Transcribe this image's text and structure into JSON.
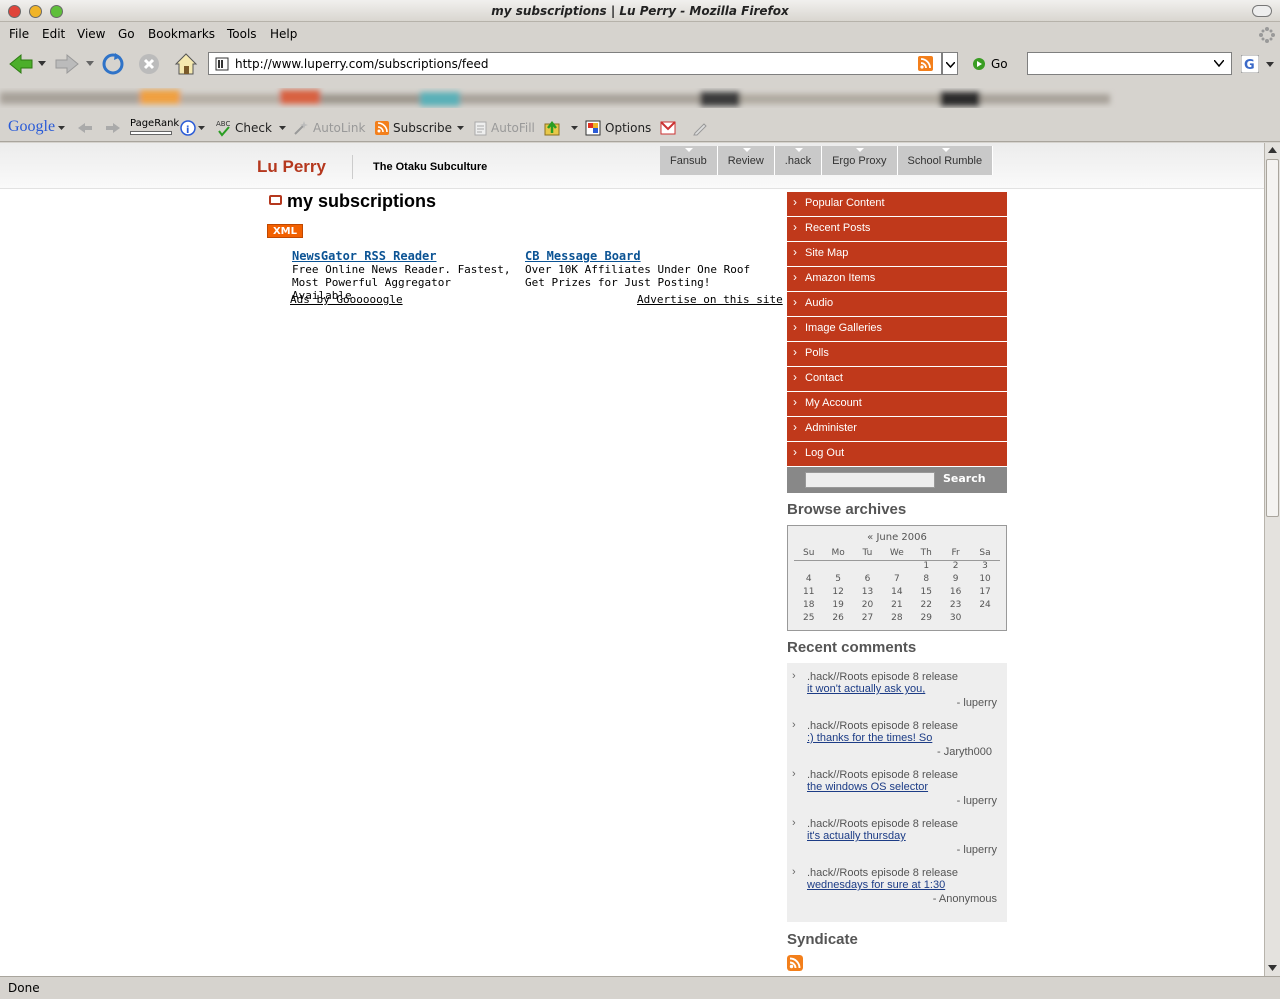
{
  "window": {
    "title": "my subscriptions | Lu Perry - Mozilla Firefox"
  },
  "menubar": {
    "items": [
      "File",
      "Edit",
      "View",
      "Go",
      "Bookmarks",
      "Tools",
      "Help"
    ]
  },
  "navbar": {
    "url": "http://www.luperry.com/subscriptions/feed",
    "go_label": "Go"
  },
  "googlebar": {
    "logo": "Google",
    "pagerank": "PageRank",
    "check": "Check",
    "autolink": "AutoLink",
    "subscribe": "Subscribe",
    "autofill": "AutoFill",
    "options": "Options"
  },
  "status": "Done",
  "site": {
    "name": "Lu Perry",
    "slogan": "The Otaku Subculture"
  },
  "tabs": [
    "Fansub",
    "Review",
    ".hack",
    "Ergo Proxy",
    "School Rumble"
  ],
  "page": {
    "title": "my subscriptions",
    "xml_badge": "XML"
  },
  "ads": [
    {
      "title": "NewsGator RSS Reader",
      "text": "Free Online News Reader. Fastest, Most Powerful Aggregator Available"
    },
    {
      "title": "CB Message Board",
      "text": "Over 10K Affiliates Under One Roof Get Prizes for Just Posting!"
    }
  ],
  "ads_footer": {
    "left": "Ads by Goooooogle",
    "right": "Advertise on this site"
  },
  "nav": [
    "Popular Content",
    "Recent Posts",
    "Site Map",
    "Amazon Items",
    "Audio",
    "Image Galleries",
    "Polls",
    "Contact",
    "My Account",
    "Administer",
    "Log Out"
  ],
  "search": {
    "button": "Search"
  },
  "archives": {
    "title": "Browse archives",
    "month": "« June 2006",
    "days": [
      "Su",
      "Mo",
      "Tu",
      "We",
      "Th",
      "Fr",
      "Sa"
    ],
    "weeks": [
      [
        "",
        "",
        "",
        "",
        "1",
        "2",
        "3"
      ],
      [
        "4",
        "5",
        "6",
        "7",
        "8",
        "9",
        "10"
      ],
      [
        "11",
        "12",
        "13",
        "14",
        "15",
        "16",
        "17"
      ],
      [
        "18",
        "19",
        "20",
        "21",
        "22",
        "23",
        "24"
      ],
      [
        "25",
        "26",
        "27",
        "28",
        "29",
        "30",
        ""
      ]
    ]
  },
  "comments": {
    "title": "Recent comments",
    "items": [
      {
        "post": ".hack//Roots episode 8 release",
        "link": "it won't actually ask you,",
        "author": "- luperry"
      },
      {
        "post": ".hack//Roots episode 8 release",
        "link": ":) thanks for the times! So",
        "author": "- Jaryth000"
      },
      {
        "post": ".hack//Roots episode 8 release",
        "link": "the windows OS selector",
        "author": "- luperry"
      },
      {
        "post": ".hack//Roots episode 8 release",
        "link": "it's actually thursday",
        "author": "- luperry"
      },
      {
        "post": ".hack//Roots episode 8 release",
        "link": "wednesdays for sure at 1:30",
        "author": "- Anonymous"
      }
    ]
  },
  "syndicate": {
    "title": "Syndicate"
  }
}
